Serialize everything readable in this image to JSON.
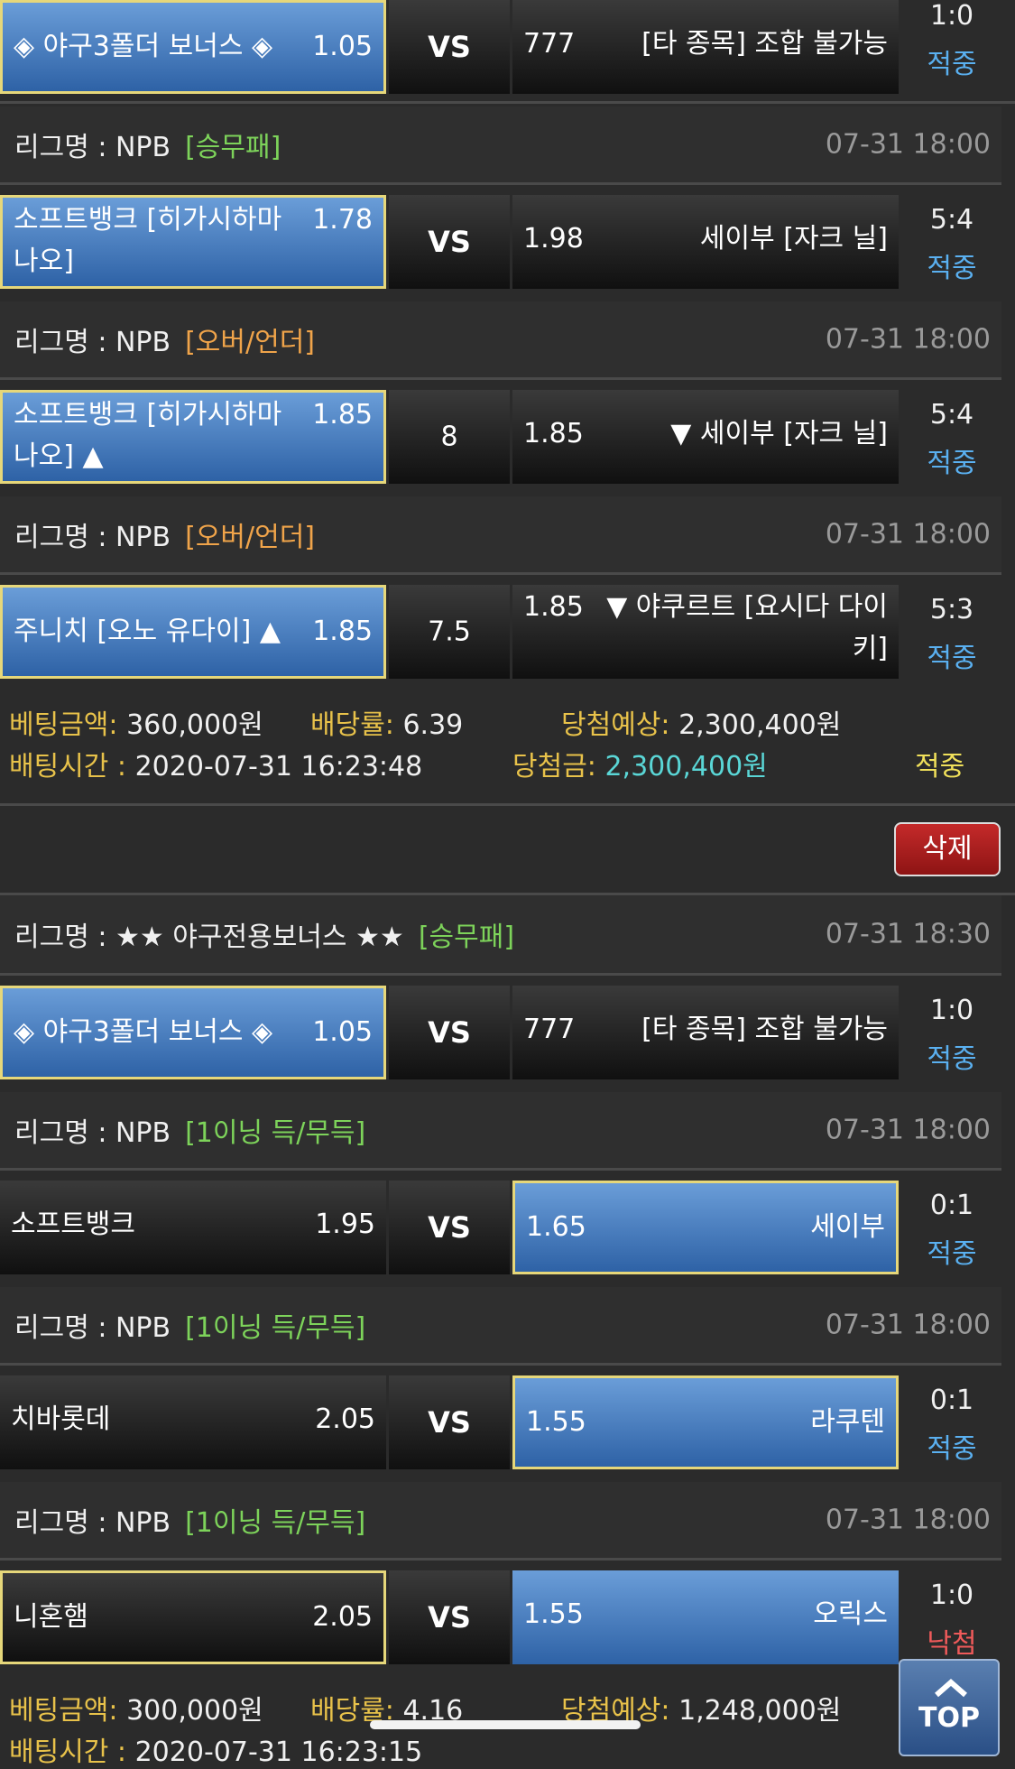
{
  "leagues": {
    "l1": {
      "name": "리그명 : NPB",
      "type": "[승무패]",
      "time": "07-31 18:00"
    },
    "l2": {
      "name": "리그명 : NPB",
      "type": "[오버/언더]",
      "time": "07-31 18:00"
    },
    "l3": {
      "name": "리그명 : NPB",
      "type": "[오버/언더]",
      "time": "07-31 18:00"
    },
    "l4": {
      "name": "리그명 : ★★ 야구전용보너스 ★★",
      "type": "[승무패]",
      "time": "07-31 18:30"
    },
    "l5": {
      "name": "리그명 : NPB",
      "type": "[1이닝 득/무득]",
      "time": "07-31 18:00"
    },
    "l6": {
      "name": "리그명 : NPB",
      "type": "[1이닝 득/무득]",
      "time": "07-31 18:00"
    },
    "l7": {
      "name": "리그명 : NPB",
      "type": "[1이닝 득/무득]",
      "time": "07-31 18:00"
    }
  },
  "matches": {
    "m0": {
      "home": "◈ 야구3폴더 보너스 ◈",
      "home_odd": "1.05",
      "mid": "VS",
      "away_odd": "777",
      "away": "[타 종목] 조합 불가능",
      "score": "1:0",
      "status": "적중"
    },
    "m1": {
      "home_l1": "소프트뱅크 [히가시하마",
      "home_l2": "나오]",
      "home_odd": "1.78",
      "mid": "VS",
      "away_odd": "1.98",
      "away": "세이부 [자크 닐]",
      "score": "5:4",
      "status": "적중"
    },
    "m2": {
      "home_l1": "소프트뱅크 [히가시하마",
      "home_l2": "나오] ▲",
      "home_odd": "1.85",
      "mid": "8",
      "away_odd": "1.85",
      "away": "▼ 세이부 [자크 닐]",
      "score": "5:4",
      "status": "적중"
    },
    "m3": {
      "home": "주니치 [오노 유다이] ▲",
      "home_odd": "1.85",
      "mid": "7.5",
      "away_odd": "1.85",
      "away_l1": "▼ 야쿠르트 [요시다 다이",
      "away_l2": "키]",
      "score": "5:3",
      "status": "적중"
    },
    "m4": {
      "home": "◈ 야구3폴더 보너스 ◈",
      "home_odd": "1.05",
      "mid": "VS",
      "away_odd": "777",
      "away": "[타 종목] 조합 불가능",
      "score": "1:0",
      "status": "적중"
    },
    "m5": {
      "home": "소프트뱅크",
      "home_odd": "1.95",
      "mid": "VS",
      "away_odd": "1.65",
      "away": "세이부",
      "score": "0:1",
      "status": "적중"
    },
    "m6": {
      "home": "치바롯데",
      "home_odd": "2.05",
      "mid": "VS",
      "away_odd": "1.55",
      "away": "라쿠텐",
      "score": "0:1",
      "status": "적중"
    },
    "m7": {
      "home": "니혼햄",
      "home_odd": "2.05",
      "mid": "VS",
      "away_odd": "1.55",
      "away": "오릭스",
      "score": "1:0",
      "status": "낙첨"
    }
  },
  "summary1": {
    "amount_label": "베팅금액:",
    "amount": "360,000원",
    "rate_label": "배당률:",
    "rate": "6.39",
    "expected_label": "당첨예상:",
    "expected": "2,300,400원",
    "time_label": "배팅시간 :",
    "time": "2020-07-31 16:23:48",
    "win_label": "당첨금:",
    "win": "2,300,400원",
    "result": "적중"
  },
  "delete_button": "삭제",
  "summary2": {
    "amount_label": "베팅금액:",
    "amount": "300,000원",
    "rate_label": "배당률:",
    "rate": "4.16",
    "expected_label": "당첨예상:",
    "expected": "1,248,000원",
    "time_label": "배팅시간 :",
    "time": "2020-07-31 16:23:15"
  },
  "top_button": "TOP"
}
